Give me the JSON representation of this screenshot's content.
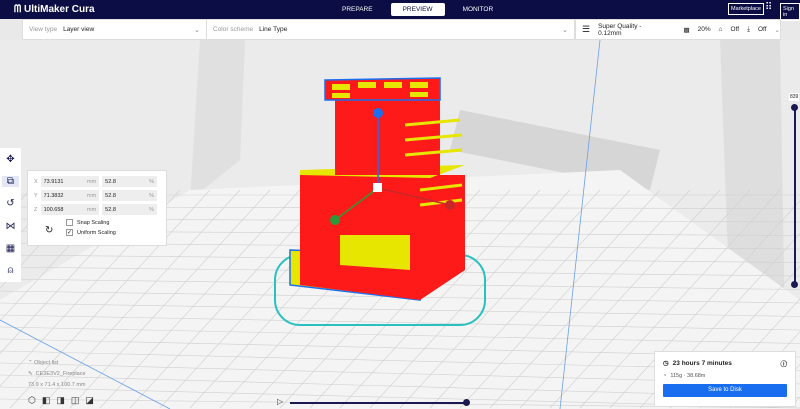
{
  "app": {
    "title": "UltiMaker Cura"
  },
  "nav": {
    "tabs": [
      {
        "label": "PREPARE"
      },
      {
        "label": "PREVIEW",
        "active": true
      },
      {
        "label": "MONITOR"
      }
    ],
    "marketplace": "Marketplace",
    "signin": "Sign in"
  },
  "viewbar": {
    "view_type_label": "View type",
    "view_type": "Layer view",
    "color_scheme_label": "Color scheme",
    "color_scheme": "Line Type"
  },
  "settings": {
    "profile": "Super Quality - 0.12mm",
    "infill": "20%",
    "support": "Off",
    "adhesion": "Off"
  },
  "scale": {
    "rows": [
      {
        "axis": "X",
        "mm": "73.9131",
        "pct": "52.8"
      },
      {
        "axis": "Y",
        "mm": "71.3832",
        "pct": "52.8"
      },
      {
        "axis": "Z",
        "mm": "100.658",
        "pct": "52.8"
      }
    ],
    "unit_mm": "mm",
    "unit_pct": "%",
    "snap": "Snap Scaling",
    "snap_checked": false,
    "uniform": "Uniform Scaling",
    "uniform_checked": true
  },
  "object": {
    "list_label": "Object list",
    "name": "CE3E3V2_Fireplace",
    "dimensions": "73.9 x 71.4 x 100.7 mm"
  },
  "layer": {
    "current": "839"
  },
  "print": {
    "time": "23 hours 7 minutes",
    "material": "115g · 38.68m",
    "save": "Save to Disk"
  },
  "colors": {
    "accent": "#196ef0",
    "topbar": "#0b0d44",
    "model": "#ff1a1a",
    "infill": "#e6e600",
    "shell": "#1a6ef0"
  }
}
